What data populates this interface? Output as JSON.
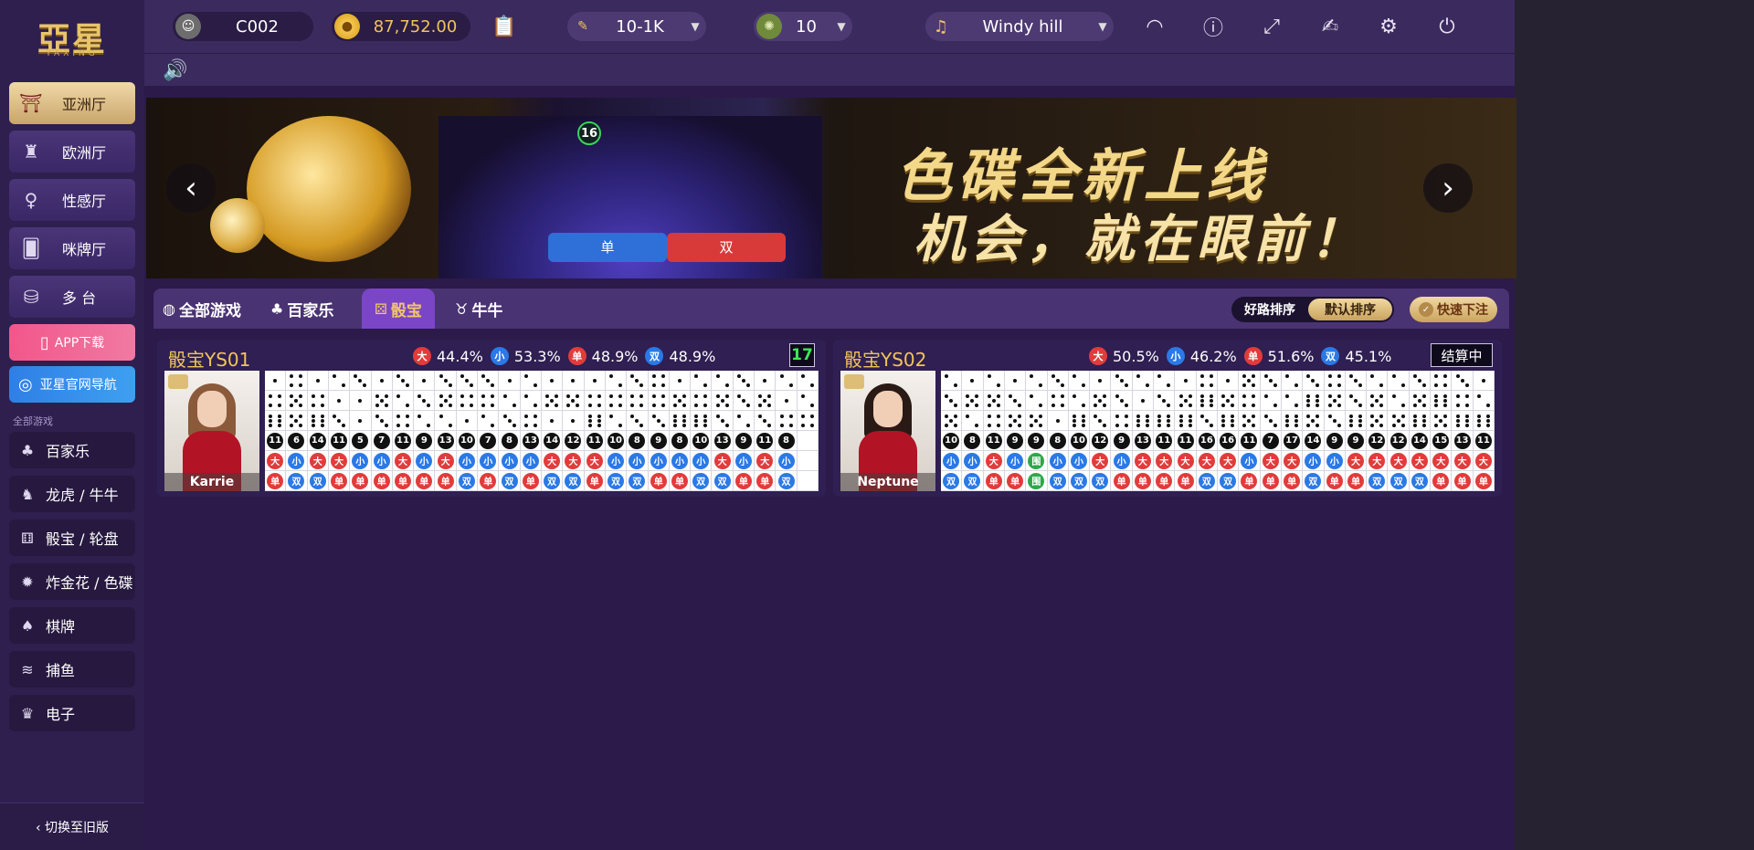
{
  "brand": {
    "logo_text": "亞星",
    "logo_sub": "YAXING"
  },
  "sidebar": {
    "halls": [
      {
        "label": "亚洲厅",
        "icon": "pagoda-icon",
        "glyph": "⛩",
        "active": true
      },
      {
        "label": "欧洲厅",
        "icon": "eiffel-tower-icon",
        "glyph": "♜",
        "active": false
      },
      {
        "label": "性感厅",
        "icon": "sexy-lady-icon",
        "glyph": "♀",
        "active": false
      },
      {
        "label": "咪牌厅",
        "icon": "peek-card-icon",
        "glyph": "🂠",
        "active": false
      },
      {
        "label": "多 台",
        "icon": "multi-table-icon",
        "glyph": "⛁",
        "active": false
      }
    ],
    "app_download": "APP下载",
    "official_nav": "亚星官网导航",
    "category_label": "全部游戏",
    "categories": [
      {
        "label": "百家乐",
        "icon": "baccarat-icon",
        "glyph": "♣"
      },
      {
        "label": "龙虎 / 牛牛",
        "icon": "dragon-tiger-icon",
        "glyph": "♞"
      },
      {
        "label": "骰宝 / 轮盘",
        "icon": "dice-icon",
        "glyph": "⚅"
      },
      {
        "label": "炸金花 / 色碟",
        "icon": "bomb-icon",
        "glyph": "✹"
      },
      {
        "label": "棋牌",
        "icon": "cards-icon",
        "glyph": "♠"
      },
      {
        "label": "捕鱼",
        "icon": "fish-icon",
        "glyph": "≋"
      },
      {
        "label": "电子",
        "icon": "slot-icon",
        "glyph": "♛"
      }
    ],
    "switch_old": "‹ 切换至旧版"
  },
  "topbar": {
    "user": "C002",
    "balance": "87,752.00",
    "limit": "10-1K",
    "chip": "10",
    "music": "Windy hill"
  },
  "banner": {
    "timer": "16",
    "headline": "色碟全新上线",
    "subline": "机会，就在眼前！",
    "odd_label": "单",
    "even_label": "双"
  },
  "filters": {
    "tabs": [
      {
        "label": "全部游戏",
        "icon": "globe-icon",
        "glyph": "◍",
        "active": false
      },
      {
        "label": "百家乐",
        "icon": "baccarat-tab-icon",
        "glyph": "♣",
        "active": false
      },
      {
        "label": "骰宝",
        "icon": "dice-tab-icon",
        "glyph": "⚄",
        "active": true
      },
      {
        "label": "牛牛",
        "icon": "bull-icon",
        "glyph": "♉",
        "active": false
      }
    ],
    "sort_good": "好路排序",
    "sort_default": "默认排序",
    "quick_bet": "快速下注"
  },
  "tables": [
    {
      "name": "骰宝YS01",
      "stats": [
        {
          "label": "大",
          "value": "44.4%",
          "color": "#e23b3b"
        },
        {
          "label": "小",
          "value": "53.3%",
          "color": "#2a79e6"
        },
        {
          "label": "单",
          "value": "48.9%",
          "color": "#e23b3b"
        },
        {
          "label": "双",
          "value": "48.9%",
          "color": "#2a79e6"
        }
      ],
      "status": "17",
      "status_type": "count",
      "dealer": "Karrie",
      "hair": "#8a5a3a",
      "dice": [
        [
          1,
          4,
          1,
          2,
          3,
          1,
          3,
          1,
          3,
          3,
          3,
          1,
          2,
          1,
          1,
          1,
          2,
          3,
          4,
          1,
          2,
          2,
          3,
          1,
          2,
          2
        ],
        [
          4,
          5,
          4,
          1,
          1,
          5,
          2,
          3,
          5,
          4,
          4,
          2,
          2,
          5,
          5,
          4,
          4,
          4,
          4,
          5,
          4,
          5,
          3,
          5,
          1,
          2
        ],
        [
          6,
          5,
          6,
          3,
          1,
          3,
          4,
          2,
          2,
          1,
          2,
          3,
          4,
          1,
          1,
          6,
          2,
          3,
          3,
          6,
          6,
          3,
          2,
          3,
          4,
          4
        ]
      ],
      "totals": [
        "11",
        "6",
        "14",
        "11",
        "5",
        "7",
        "11",
        "9",
        "13",
        "10",
        "7",
        "8",
        "13",
        "14",
        "12",
        "11",
        "10",
        "8",
        "9",
        "8",
        "10",
        "13",
        "9",
        "11",
        "8"
      ],
      "bigsmall": [
        "大",
        "小",
        "大",
        "大",
        "小",
        "小",
        "大",
        "小",
        "大",
        "小",
        "小",
        "小",
        "小",
        "大",
        "大",
        "大",
        "小",
        "小",
        "小",
        "小",
        "小",
        "大",
        "小",
        "大",
        "小"
      ],
      "oddeven": [
        "单",
        "双",
        "双",
        "单",
        "单",
        "单",
        "单",
        "单",
        "单",
        "双",
        "单",
        "双",
        "单",
        "双",
        "双",
        "单",
        "双",
        "双",
        "单",
        "单",
        "双",
        "双",
        "单",
        "单",
        "双"
      ]
    },
    {
      "name": "骰宝YS02",
      "stats": [
        {
          "label": "大",
          "value": "50.5%",
          "color": "#e23b3b"
        },
        {
          "label": "小",
          "value": "46.2%",
          "color": "#2a79e6"
        },
        {
          "label": "单",
          "value": "51.6%",
          "color": "#e23b3b"
        },
        {
          "label": "双",
          "value": "45.1%",
          "color": "#2a79e6"
        }
      ],
      "status": "结算中",
      "status_type": "settle",
      "dealer": "Neptune",
      "hair": "#2a1a16",
      "dice": [
        [
          2,
          1,
          2,
          1,
          2,
          3,
          2,
          1,
          3,
          2,
          2,
          1,
          4,
          1,
          5,
          3,
          2,
          3,
          4,
          3,
          2,
          2,
          3,
          4,
          3,
          1
        ],
        [
          3,
          5,
          5,
          3,
          2,
          4,
          2,
          5,
          3,
          1,
          3,
          5,
          6,
          5,
          4,
          2,
          2,
          6,
          5,
          3,
          5,
          2,
          5,
          6,
          4,
          2
        ],
        [
          5,
          2,
          4,
          5,
          5,
          1,
          6,
          3,
          4,
          6,
          6,
          6,
          3,
          6,
          5,
          3,
          6,
          5,
          3,
          6,
          5,
          5,
          6,
          5,
          6,
          6
        ]
      ],
      "totals": [
        "10",
        "8",
        "11",
        "9",
        "9",
        "8",
        "10",
        "12",
        "9",
        "13",
        "11",
        "11",
        "16",
        "16",
        "11",
        "7",
        "17",
        "14",
        "9",
        "9",
        "12",
        "12",
        "14",
        "15",
        "13",
        "11"
      ],
      "bigsmall": [
        "小",
        "小",
        "大",
        "小",
        "围",
        "小",
        "小",
        "大",
        "小",
        "大",
        "大",
        "大",
        "大",
        "大",
        "小",
        "大",
        "大",
        "小",
        "小",
        "大",
        "大",
        "大",
        "大",
        "大",
        "大",
        "大"
      ],
      "oddeven": [
        "双",
        "双",
        "单",
        "单",
        "围",
        "双",
        "双",
        "双",
        "单",
        "单",
        "单",
        "单",
        "双",
        "双",
        "单",
        "单",
        "单",
        "双",
        "单",
        "单",
        "双",
        "双",
        "双",
        "单",
        "单",
        "单"
      ]
    }
  ],
  "colors": {
    "accent": "#7b45c8",
    "gold": "#f1c45a",
    "red": "#e23b3b",
    "blue": "#2a79e6",
    "green": "#2ea84a"
  }
}
